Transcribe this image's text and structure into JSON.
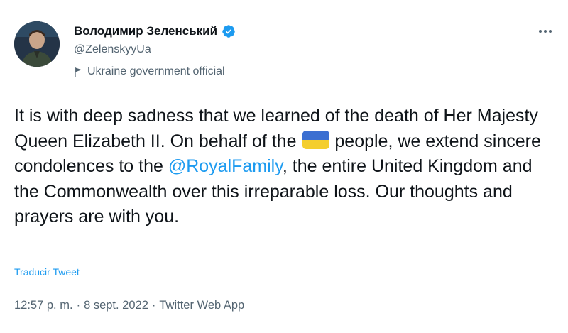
{
  "author": {
    "display_name": "Володимир Зеленський",
    "handle": "@ZelenskyyUa",
    "label": "Ukraine government official",
    "avatar_icon": "avatar-photo",
    "verified_icon": "verified-badge-icon"
  },
  "tweet": {
    "text_part1": "It is with deep sadness that we learned of the death of Her Majesty Queen Elizabeth II. On behalf of the ",
    "flag_emoji": "ukraine-flag",
    "text_part2": " people, we extend sincere condolences to the ",
    "mention": "@RoyalFamily",
    "text_part3": ", the entire United Kingdom and the Commonwealth over this irreparable loss. Our thoughts and prayers are with you.",
    "translate_label": "Traducir Tweet"
  },
  "meta": {
    "time": "12:57 p. m.",
    "separator": "·",
    "date": "8 sept. 2022",
    "source": "Twitter Web App"
  },
  "colors": {
    "text": "#0f1419",
    "secondary": "#536471",
    "link": "#1d9bf0",
    "flag_blue": "#3b6fd1",
    "flag_yellow": "#f4ce2e"
  }
}
